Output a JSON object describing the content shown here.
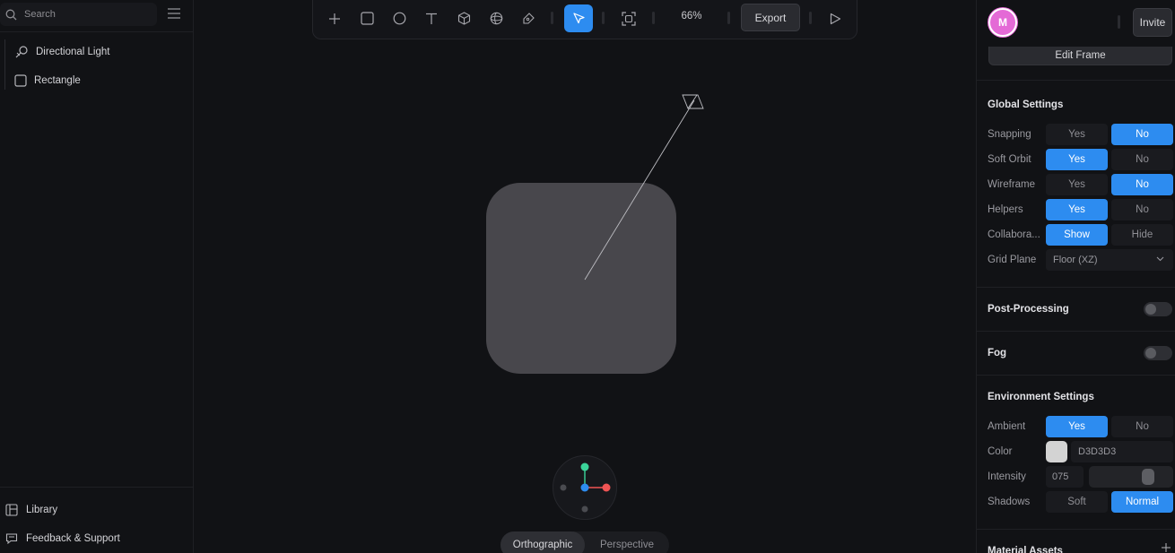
{
  "left": {
    "search_placeholder": "Search",
    "layers": [
      {
        "label": "Directional Light",
        "icon": "directional-light-icon"
      },
      {
        "label": "Rectangle",
        "icon": "rectangle-icon"
      }
    ],
    "bottom": [
      {
        "label": "Library",
        "icon": "library-icon"
      },
      {
        "label": "Feedback & Support",
        "icon": "feedback-icon"
      }
    ]
  },
  "toolbar": {
    "tools": [
      "plus-icon",
      "square-icon",
      "circle-icon",
      "text-icon",
      "cube-icon",
      "globe-icon",
      "pen-icon",
      "pointer-icon",
      "frame-icon",
      "play-icon"
    ],
    "active_tool": "pointer-icon",
    "zoom": "66%",
    "export_label": "Export"
  },
  "canvas": {
    "shape_color": "#48474c",
    "view_modes": [
      "Orthographic",
      "Perspective"
    ],
    "active_view": "Orthographic"
  },
  "right": {
    "avatar_initial": "M",
    "avatar_color": "#e46ad6",
    "invite_label": "Invite",
    "edit_frame_label": "Edit Frame",
    "global_settings": {
      "title": "Global Settings",
      "rows": [
        {
          "label": "Snapping",
          "options": [
            "Yes",
            "No"
          ],
          "selected": 1
        },
        {
          "label": "Soft Orbit",
          "options": [
            "Yes",
            "No"
          ],
          "selected": 0
        },
        {
          "label": "Wireframe",
          "options": [
            "Yes",
            "No"
          ],
          "selected": 1
        },
        {
          "label": "Helpers",
          "options": [
            "Yes",
            "No"
          ],
          "selected": 0
        },
        {
          "label": "Collabora...",
          "options": [
            "Show",
            "Hide"
          ],
          "selected": 0
        }
      ],
      "grid_plane_label": "Grid Plane",
      "grid_plane_value": "Floor (XZ)"
    },
    "post_processing": {
      "title": "Post-Processing",
      "enabled": false
    },
    "fog": {
      "title": "Fog",
      "enabled": false
    },
    "environment": {
      "title": "Environment Settings",
      "ambient_label": "Ambient",
      "ambient_options": [
        "Yes",
        "No"
      ],
      "ambient_selected": 0,
      "color_label": "Color",
      "color_value": "D3D3D3",
      "color_hex": "#d3d3d3",
      "intensity_label": "Intensity",
      "intensity_value": "075",
      "intensity_level": 0.75,
      "shadows_label": "Shadows",
      "shadows_options": [
        "Soft",
        "Normal"
      ],
      "shadows_selected": 1
    },
    "material_assets_title": "Material Assets"
  },
  "colors": {
    "accent": "#2d8cf0",
    "background": "#111215",
    "gizmo_x": "#f05454",
    "gizmo_y": "#3bd49a",
    "gizmo_z": "#2d8cf0"
  }
}
